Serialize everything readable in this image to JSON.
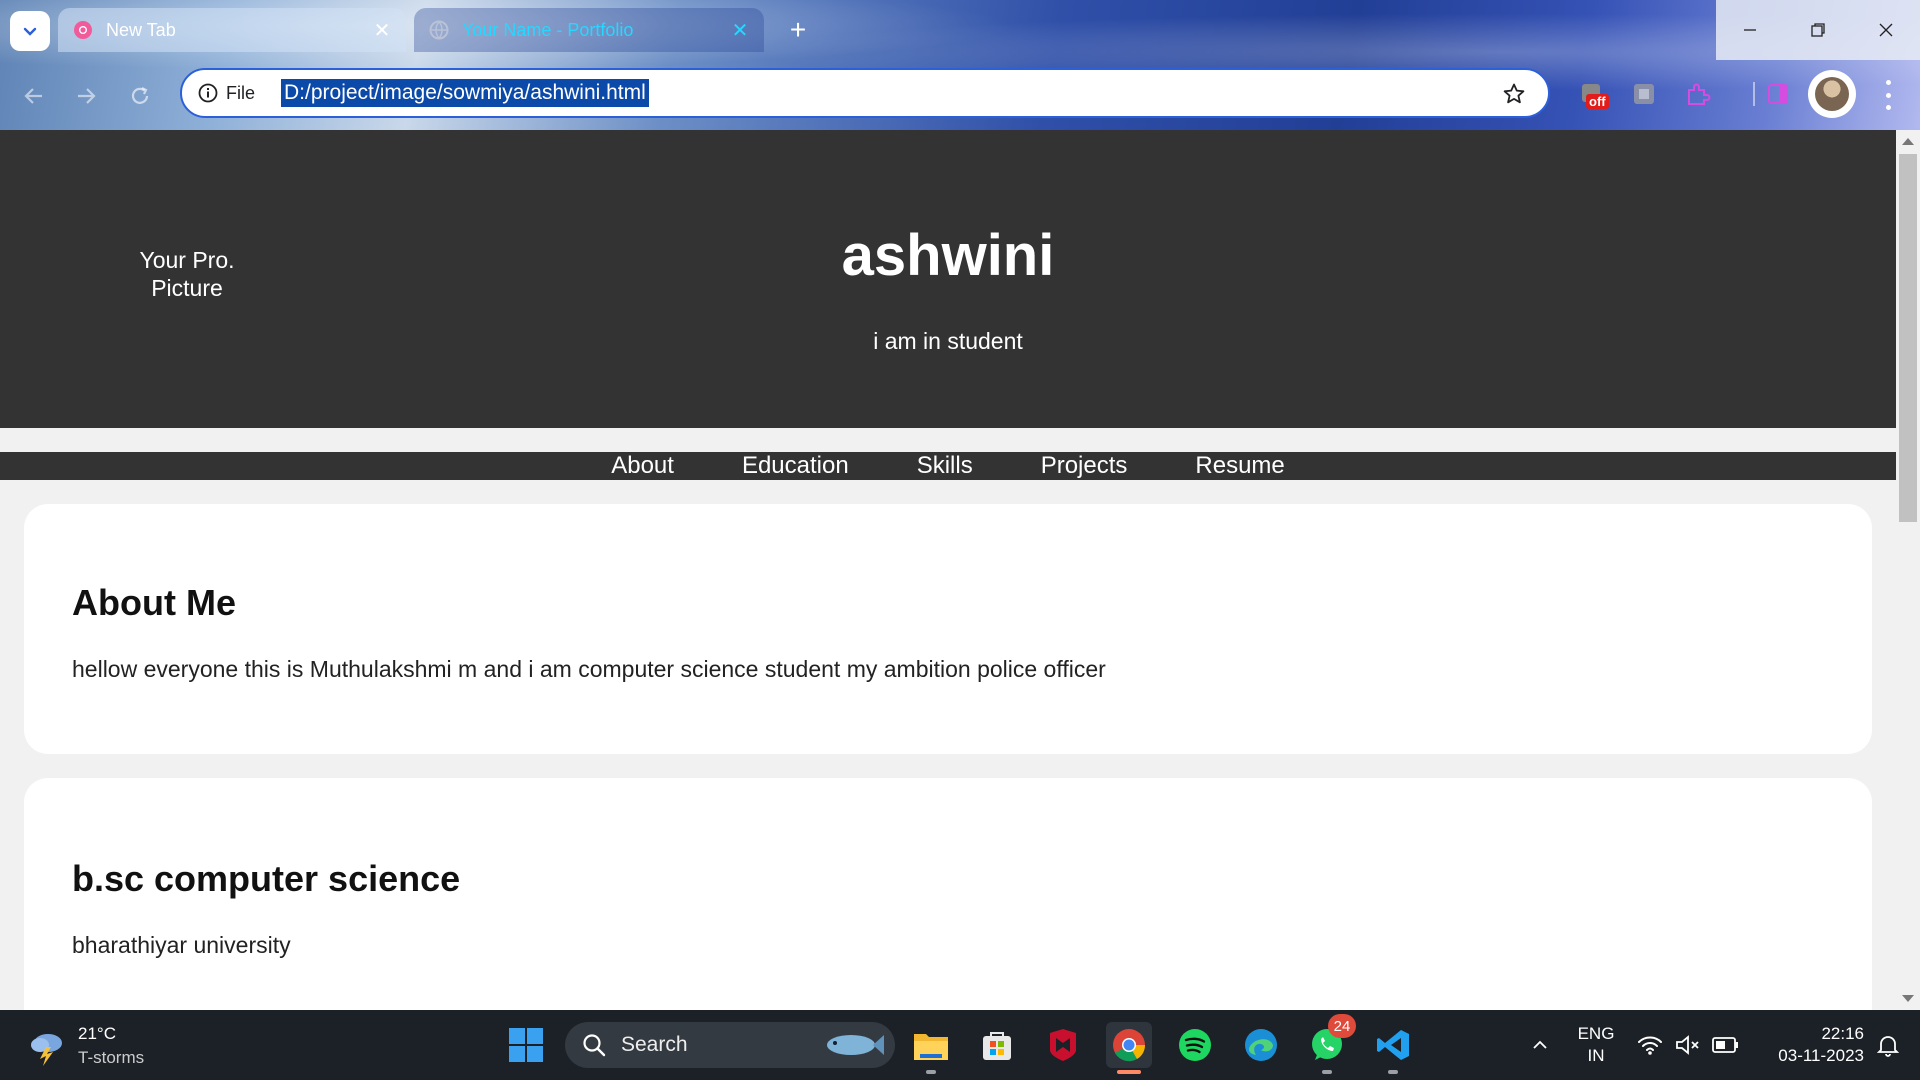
{
  "browser": {
    "tabs": [
      {
        "title": "New Tab",
        "active": false
      },
      {
        "title": "Your Name - Portfolio",
        "active": true
      }
    ],
    "address": {
      "scheme_label": "File",
      "url": "D:/project/image/sowmiya/ashwini.html"
    },
    "extension_badge": "off",
    "accent_color": "#2c60d9"
  },
  "page": {
    "header": {
      "profile_picture_alt": "Your Profile Picture",
      "profile_picture_line1": "Your Pro.",
      "profile_picture_line2": "Picture",
      "name": "ashwini",
      "tagline": "i am in student"
    },
    "nav": [
      "About",
      "Education",
      "Skills",
      "Projects",
      "Resume"
    ],
    "about": {
      "heading": "About Me",
      "text": "hellow everyone this is Muthulakshmi m and i am computer science student my ambition police officer"
    },
    "education": {
      "heading": "b.sc computer science",
      "text": "bharathiyar university"
    },
    "header_bg": "#333333"
  },
  "taskbar": {
    "weather": {
      "temp": "21°C",
      "condition": "T-storms"
    },
    "search_label": "Search",
    "whatsapp_badge": "24",
    "language": {
      "line1": "ENG",
      "line2": "IN"
    },
    "clock": {
      "time": "22:16",
      "date": "03-11-2023"
    }
  }
}
